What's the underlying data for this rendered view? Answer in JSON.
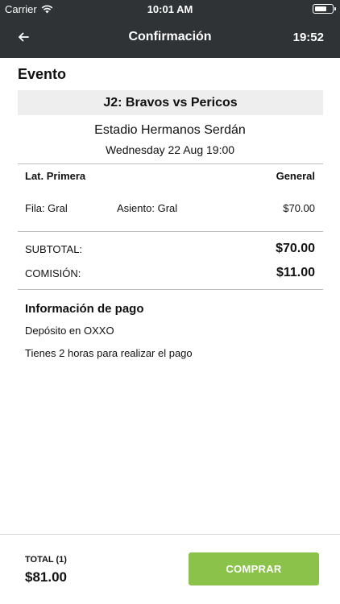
{
  "status_bar": {
    "carrier": "Carrier",
    "time": "10:01 AM"
  },
  "header": {
    "title": "Confirmación",
    "timer": "19:52",
    "back_icon": "arrow-left-icon",
    "background": "#2f3336"
  },
  "event": {
    "section_title": "Evento",
    "name": "J2: Bravos vs Pericos",
    "venue": "Estadio Hermanos Serdán",
    "date": "Wednesday 22 Aug 19:00"
  },
  "ticket": {
    "section": "Lat. Primera",
    "type": "General",
    "row": "Fila: Gral",
    "seat": "Asiento: Gral",
    "price": "$70.00"
  },
  "summary": {
    "subtotal_label": "SUBTOTAL:",
    "subtotal_value": "$70.00",
    "commission_label": "COMISIÓN:",
    "commission_value": "$11.00"
  },
  "payment": {
    "title": "Información de pago",
    "method": "Depósito en OXXO",
    "note": "Tienes 2 horas para realizar el pago"
  },
  "footer": {
    "total_label": "TOTAL (1)",
    "total_value": "$81.00",
    "buy_label": "COMPRAR",
    "buy_color": "#8bc34a"
  }
}
